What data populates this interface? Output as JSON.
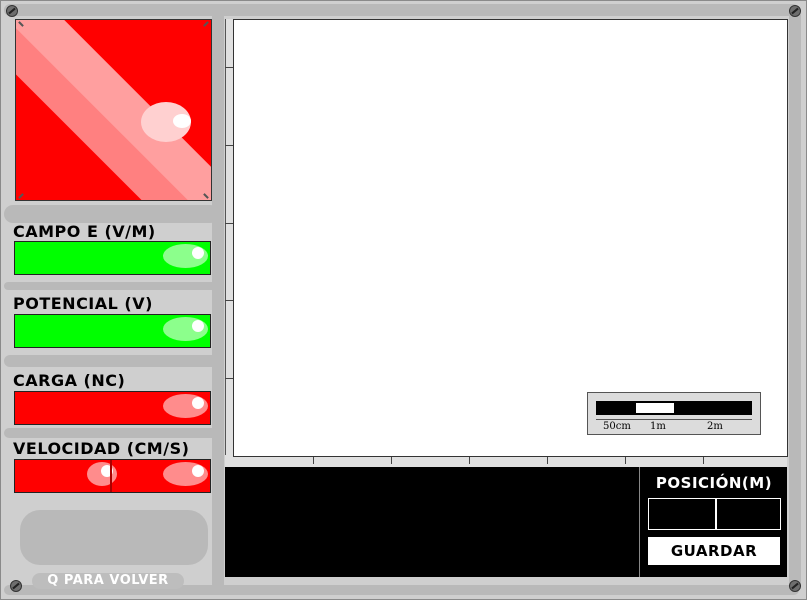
{
  "meters": {
    "campo_label": "CAMPO E (V/M)",
    "potencial_label": "POTENCIAL (V)",
    "carga_label": "CARGA (NC)",
    "velocidad_label": "VELOCIDAD (CM/S)"
  },
  "scale": {
    "labels": [
      "50cm",
      "1m",
      "2m"
    ]
  },
  "position_panel": {
    "title": "POSICIÓN(M)",
    "x_value": "",
    "y_value": "",
    "save_label": "GUARDAR"
  },
  "footer": {
    "back_label": "Q PARA VOLVER"
  },
  "colors": {
    "field_meter": "#00ff00",
    "charge_meter": "#ff0000",
    "plot_bg": "#ffffff",
    "panel_bg": "#000000"
  }
}
